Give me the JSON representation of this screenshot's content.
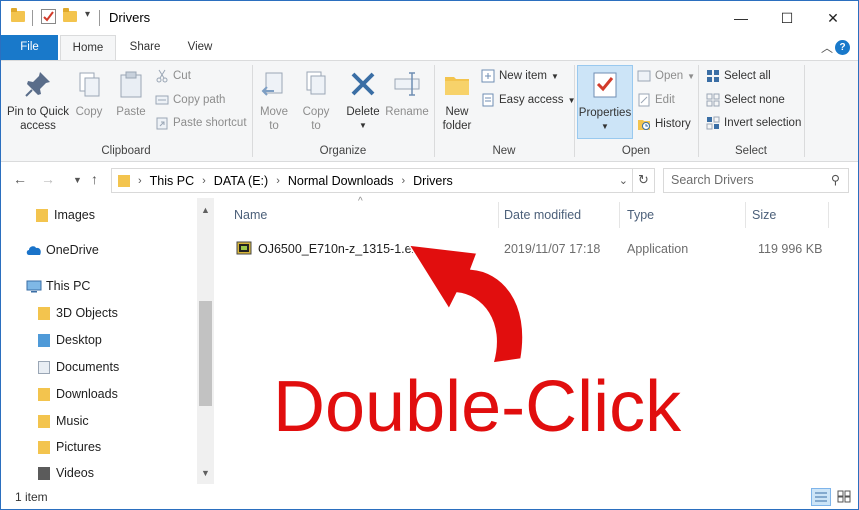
{
  "window": {
    "title": "Drivers",
    "minimize_glyph": "—",
    "maximize_glyph": "☐",
    "close_glyph": "✕"
  },
  "ribbon_tabs": [
    {
      "label": "File"
    },
    {
      "label": "Home"
    },
    {
      "label": "Share"
    },
    {
      "label": "View"
    }
  ],
  "ribbon": {
    "clipboard": {
      "label": "Clipboard",
      "pin": "Pin to Quick access",
      "pin_line1": "Pin to Quick",
      "pin_line2": "access",
      "copy": "Copy",
      "paste": "Paste",
      "cut": "Cut",
      "copy_path": "Copy path",
      "paste_shortcut": "Paste shortcut"
    },
    "organize": {
      "label": "Organize",
      "move_to_1": "Move",
      "move_to_2": "to",
      "copy_to_1": "Copy",
      "copy_to_2": "to",
      "delete": "Delete",
      "rename": "Rename"
    },
    "new": {
      "label": "New",
      "new_folder_1": "New",
      "new_folder_2": "folder",
      "new_item": "New item",
      "easy_access": "Easy access"
    },
    "open": {
      "label": "Open",
      "properties": "Properties",
      "open": "Open",
      "edit": "Edit",
      "history": "History"
    },
    "select": {
      "label": "Select",
      "select_all": "Select all",
      "select_none": "Select none",
      "invert": "Invert selection"
    }
  },
  "address": {
    "crumbs": [
      "This PC",
      "DATA (E:)",
      "Normal Downloads",
      "Drivers"
    ],
    "search_placeholder": "Search Drivers"
  },
  "nav_pane": {
    "items": [
      {
        "label": "Images",
        "icon": "folder-icon"
      },
      {
        "label": "OneDrive",
        "icon": "cloud-icon"
      },
      {
        "label": "This PC",
        "icon": "computer-icon"
      },
      {
        "label": "3D Objects",
        "icon": "3d-objects-icon"
      },
      {
        "label": "Desktop",
        "icon": "desktop-icon"
      },
      {
        "label": "Documents",
        "icon": "documents-icon"
      },
      {
        "label": "Downloads",
        "icon": "downloads-icon"
      },
      {
        "label": "Music",
        "icon": "music-icon"
      },
      {
        "label": "Pictures",
        "icon": "pictures-icon"
      },
      {
        "label": "Videos",
        "icon": "videos-icon"
      }
    ]
  },
  "file_list": {
    "columns": [
      "Name",
      "Date modified",
      "Type",
      "Size"
    ],
    "rows": [
      {
        "name": "OJ6500_E710n-z_1315-1.exe",
        "date": "2019/11/07 17:18",
        "type": "Application",
        "size": "119 996 KB"
      }
    ]
  },
  "status": {
    "item_count": "1 item"
  },
  "overlay": {
    "callout": "Double-Click",
    "color": "#e10e0e"
  }
}
